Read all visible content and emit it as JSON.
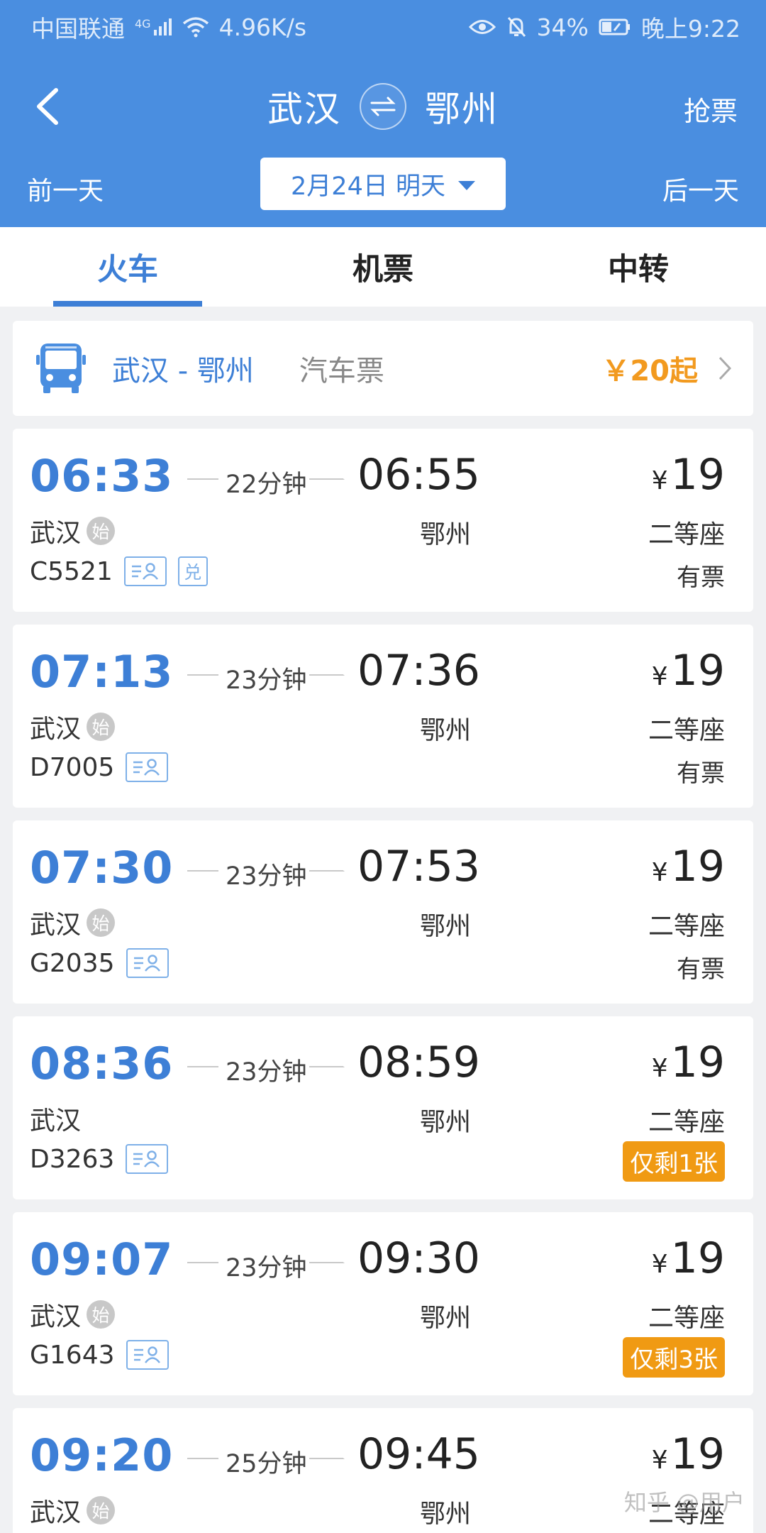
{
  "status_bar": {
    "carrier": "中国联通",
    "network": "4G",
    "speed": "4.96K/s",
    "battery": "34%",
    "time": "晚上9:22"
  },
  "header": {
    "from_city": "武汉",
    "to_city": "鄂州",
    "grab_ticket": "抢票",
    "prev_day": "前一天",
    "next_day": "后一天",
    "date": "2月24日 明天"
  },
  "tabs": [
    {
      "label": "火车",
      "active": true
    },
    {
      "label": "机票",
      "active": false
    },
    {
      "label": "中转",
      "active": false
    }
  ],
  "bus": {
    "route": "武汉 - 鄂州",
    "type": "汽车票",
    "price": "￥20起"
  },
  "trains": [
    {
      "dep_time": "06:33",
      "duration": "22分钟",
      "arr_time": "06:55",
      "currency": "¥",
      "price": "19",
      "dep_station": "武汉",
      "start_badge": "始",
      "arr_station": "鄂州",
      "seat": "二等座",
      "train_no": "C5521",
      "exchange_tag": "兑",
      "availability": "有票",
      "warn": false
    },
    {
      "dep_time": "07:13",
      "duration": "23分钟",
      "arr_time": "07:36",
      "currency": "¥",
      "price": "19",
      "dep_station": "武汉",
      "start_badge": "始",
      "arr_station": "鄂州",
      "seat": "二等座",
      "train_no": "D7005",
      "availability": "有票",
      "warn": false
    },
    {
      "dep_time": "07:30",
      "duration": "23分钟",
      "arr_time": "07:53",
      "currency": "¥",
      "price": "19",
      "dep_station": "武汉",
      "start_badge": "始",
      "arr_station": "鄂州",
      "seat": "二等座",
      "train_no": "G2035",
      "availability": "有票",
      "warn": false
    },
    {
      "dep_time": "08:36",
      "duration": "23分钟",
      "arr_time": "08:59",
      "currency": "¥",
      "price": "19",
      "dep_station": "武汉",
      "arr_station": "鄂州",
      "seat": "二等座",
      "train_no": "D3263",
      "availability": "仅剩1张",
      "warn": true
    },
    {
      "dep_time": "09:07",
      "duration": "23分钟",
      "arr_time": "09:30",
      "currency": "¥",
      "price": "19",
      "dep_station": "武汉",
      "start_badge": "始",
      "arr_station": "鄂州",
      "seat": "二等座",
      "train_no": "G1643",
      "availability": "仅剩3张",
      "warn": true
    },
    {
      "dep_time": "09:20",
      "duration": "25分钟",
      "arr_time": "09:45",
      "currency": "¥",
      "price": "19",
      "dep_station": "武汉",
      "start_badge": "始",
      "arr_station": "鄂州",
      "seat": "二等座"
    }
  ],
  "watermark": "知乎 @用户",
  "colors": {
    "header_bg": "#4a8ee0",
    "accent_blue": "#3d7fd6",
    "price_orange": "#f29a1f",
    "warn_badge": "#f09a13"
  },
  "icons": [
    "back-arrow-icon",
    "swap-icon",
    "bus-icon",
    "chevron-right-icon",
    "e-ticket-icon",
    "eye-icon",
    "bell-mute-icon",
    "battery-icon",
    "signal-icon",
    "wifi-icon"
  ]
}
